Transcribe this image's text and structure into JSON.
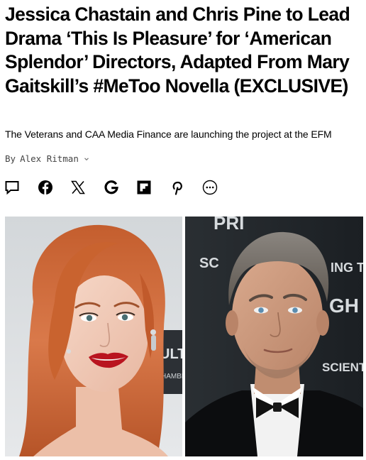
{
  "article": {
    "headline": "Jessica Chastain and Chris Pine to Lead Drama ‘This Is Pleasure’ for ‘American Splendor’ Directors, Adapted From Mary Gaitskill’s #MeToo Novella (EXCLUSIVE)",
    "dek": "The Veterans and CAA Media Finance are launching the project at the EFM",
    "byline": {
      "prefix": "By",
      "author": "Alex Ritman"
    }
  },
  "share_bar": {
    "icons": [
      "comment-icon",
      "facebook-icon",
      "x-icon",
      "google-icon",
      "flipboard-icon",
      "pinterest-icon",
      "more-icon"
    ]
  },
  "photos": {
    "left": {
      "subject": "woman with long red hair, red lipstick, drop earrings",
      "backdrop_text": [
        "ULT",
        "HAMBE"
      ]
    },
    "right": {
      "subject": "man with gray-brown hair, tuxedo and black bow tie",
      "backdrop_text": [
        "PRI",
        "SC",
        "ING T",
        "GH",
        "SCIENT"
      ]
    }
  }
}
